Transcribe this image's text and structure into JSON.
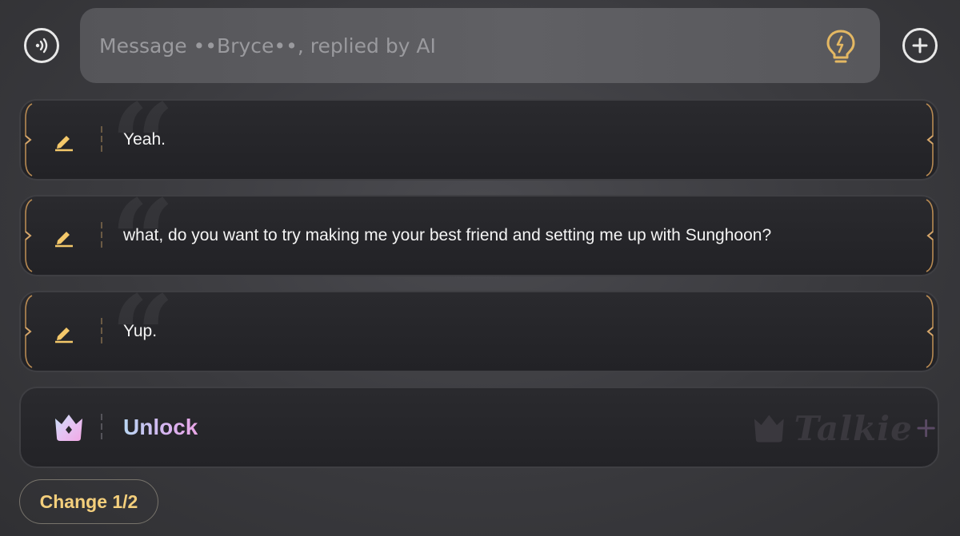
{
  "header": {
    "voice_icon": "voice-wave-icon",
    "message_placeholder": "Message ••Bryce••, replied by AI",
    "message_value": "",
    "hint_icon": "lightbulb-icon",
    "add_icon": "plus-circle-icon"
  },
  "replies": [
    {
      "text": "Yeah.",
      "icon": "pencil-icon"
    },
    {
      "text": "what, do you want to try making me your best friend and setting me up with Sunghoon?",
      "icon": "pencil-icon"
    },
    {
      "text": "Yup.",
      "icon": "pencil-icon"
    }
  ],
  "unlock": {
    "label": "Unlock",
    "icon": "crown-icon",
    "watermark": "Talkie"
  },
  "change_button": {
    "label": "Change 1/2"
  },
  "colors": {
    "accent_gold": "#f4c86a",
    "unlock_gradient_start": "#b9d6f2",
    "unlock_gradient_end": "#e9a6e6",
    "background": "#3a3a3e"
  }
}
